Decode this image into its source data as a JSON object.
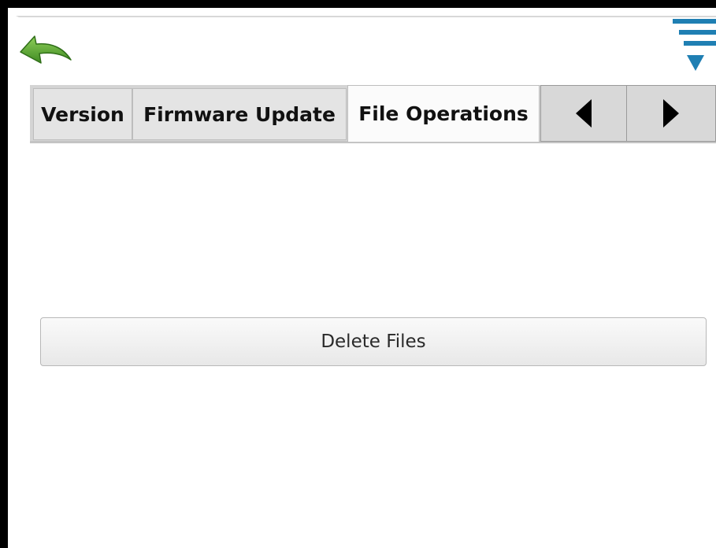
{
  "header": {
    "back_icon": "back-arrow-icon",
    "menu_icon": "menu-lines-triangle-icon",
    "accent_back": "#4f9a2e",
    "accent_menu": "#1f7fb3"
  },
  "tabs": [
    {
      "label": "Version",
      "active": false
    },
    {
      "label": "Firmware Update",
      "active": false
    },
    {
      "label": "File Operations",
      "active": true
    }
  ],
  "nav": {
    "prev_icon": "triangle-left-icon",
    "next_icon": "triangle-right-icon"
  },
  "main": {
    "delete_files_label": "Delete Files"
  }
}
